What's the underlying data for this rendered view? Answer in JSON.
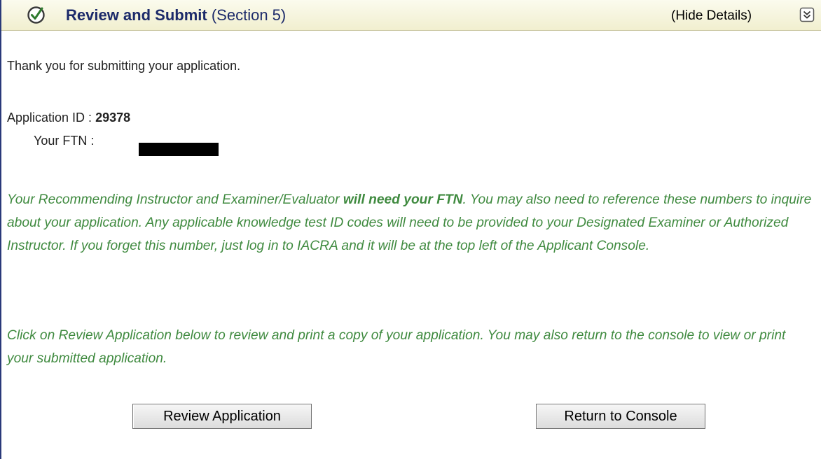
{
  "header": {
    "title": "Review and Submit",
    "section": "(Section 5)",
    "hide_details": "(Hide Details)",
    "check_icon": "check-circle-icon",
    "expand_icon": "collapse-chevron-icon"
  },
  "content": {
    "thanks": "Thank you for submitting your application.",
    "app_id_label": "Application ID : ",
    "app_id_value": "29378",
    "ftn_label": "Your FTN :",
    "para1_a": "Your Recommending Instructor and Examiner/Evaluator ",
    "para1_b": "will need your FTN",
    "para1_c": ". You may also need to reference these numbers to inquire about your application. Any applicable knowledge test ID codes will need to be provided to your Designated Examiner or Authorized Instructor. If you forget this number, just log in to IACRA and it will be at the top left of the Applicant Console.",
    "para2": "Click on Review Application below to review and print a copy of your application. You may also return to the console to view or print your submitted application."
  },
  "buttons": {
    "review": "Review Application",
    "return": "Return to Console"
  },
  "colors": {
    "title": "#1c2a6a",
    "green_text": "#3f8a3f",
    "header_bg": "#f1efcf"
  }
}
